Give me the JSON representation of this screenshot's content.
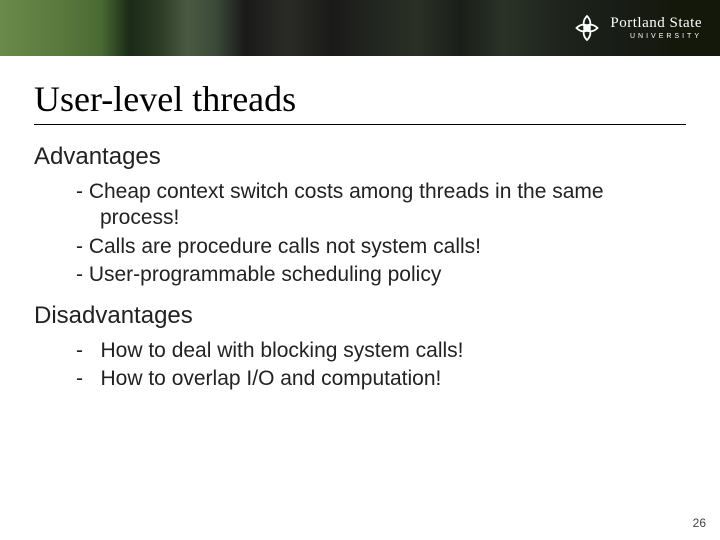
{
  "logo": {
    "main": "Portland State",
    "sub": "UNIVERSITY"
  },
  "title": "User-level threads",
  "sections": [
    {
      "heading": "Advantages",
      "items": [
        "Cheap context switch costs among threads in the same process!",
        "Calls are procedure calls not system calls!",
        "User-programmable scheduling policy"
      ]
    },
    {
      "heading": "Disadvantages",
      "items": [
        "How to deal with blocking system calls!",
        "How to overlap I/O and computation!"
      ]
    }
  ],
  "page_number": "26"
}
